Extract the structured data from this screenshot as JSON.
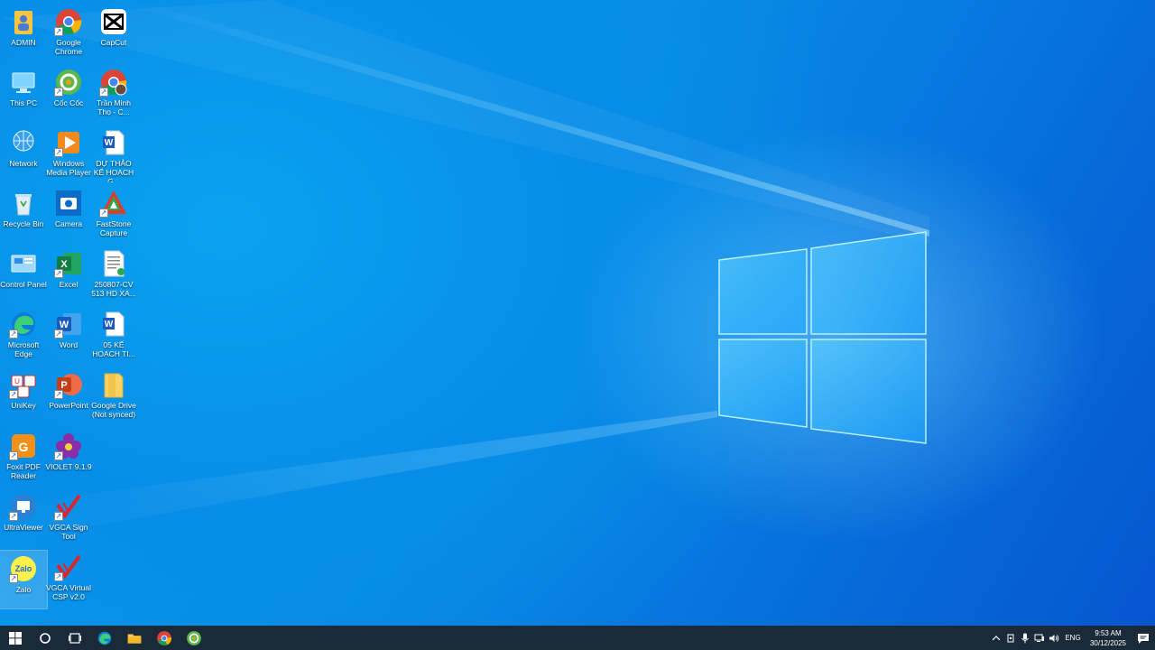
{
  "desktop_icons": [
    {
      "label": "ADMIN",
      "icon": "user-folder-icon"
    },
    {
      "label": "Google Chrome",
      "icon": "chrome-icon"
    },
    {
      "label": "CapCut",
      "icon": "capcut-icon"
    },
    {
      "label": "This PC",
      "icon": "this-pc-icon"
    },
    {
      "label": "Cốc Cốc",
      "icon": "coccoc-icon"
    },
    {
      "label": "Trần Minh Thọ - C...",
      "icon": "chrome-profile-icon"
    },
    {
      "label": "Network",
      "icon": "network-icon"
    },
    {
      "label": "Windows Media Player",
      "icon": "media-player-icon"
    },
    {
      "label": "DỰ THẢO KẾ HOẠCH G...",
      "icon": "word-document-icon"
    },
    {
      "label": "Recycle Bin",
      "icon": "recycle-bin-icon"
    },
    {
      "label": "Camera",
      "icon": "camera-icon"
    },
    {
      "label": "FastStone Capture",
      "icon": "faststone-icon"
    },
    {
      "label": "Control Panel",
      "icon": "control-panel-icon"
    },
    {
      "label": "Excel",
      "icon": "excel-icon"
    },
    {
      "label": "250807-CV 513 HD XA...",
      "icon": "document-icon"
    },
    {
      "label": "Microsoft Edge",
      "icon": "edge-icon"
    },
    {
      "label": "Word",
      "icon": "word-icon"
    },
    {
      "label": "05 KẾ HOẠCH TI...",
      "icon": "word-document-icon"
    },
    {
      "label": "UniKey",
      "icon": "unikey-icon"
    },
    {
      "label": "PowerPoint",
      "icon": "powerpoint-icon"
    },
    {
      "label": "Google Drive (Not synced)",
      "icon": "folder-icon"
    },
    {
      "label": "Foxit PDF Reader",
      "icon": "foxit-icon"
    },
    {
      "label": "VIOLET 9.1.9",
      "icon": "violet-icon"
    },
    {
      "label": "UltraViewer",
      "icon": "ultraviewer-icon"
    },
    {
      "label": "VGCA Sign Tool",
      "icon": "vgca-icon"
    },
    {
      "label": "Zalo",
      "icon": "zalo-icon"
    },
    {
      "label": "VGCA Virtual CSP v2.0",
      "icon": "vgca-icon"
    }
  ],
  "taskbar": {
    "lang": "ENG",
    "time": "9:53 AM",
    "date": "30/12/2025"
  },
  "colors": {
    "taskbar": "#1a2a38",
    "desktop_accent": "#0787e6"
  }
}
